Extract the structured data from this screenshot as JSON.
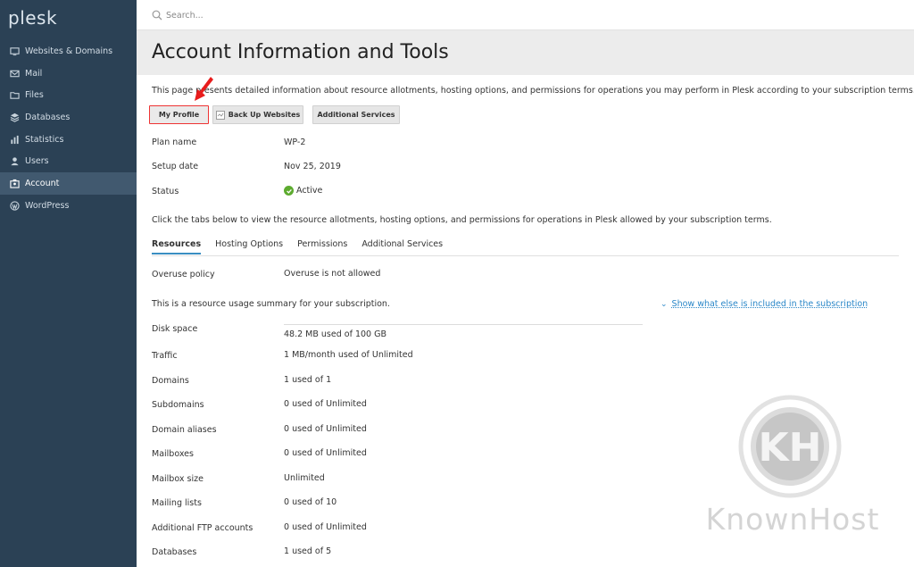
{
  "brand": {
    "logo": "plesk"
  },
  "sidebar": {
    "items": [
      {
        "label": "Websites & Domains",
        "icon": "monitor-icon"
      },
      {
        "label": "Mail",
        "icon": "mail-icon"
      },
      {
        "label": "Files",
        "icon": "folder-icon"
      },
      {
        "label": "Databases",
        "icon": "database-icon"
      },
      {
        "label": "Statistics",
        "icon": "bar-chart-icon"
      },
      {
        "label": "Users",
        "icon": "user-icon"
      },
      {
        "label": "Account",
        "icon": "account-icon",
        "active": true
      },
      {
        "label": "WordPress",
        "icon": "wordpress-icon"
      }
    ]
  },
  "search": {
    "placeholder": "Search..."
  },
  "page": {
    "title": "Account Information and Tools",
    "description": "This page presents detailed information about resource allotments, hosting options, and permissions for operations you may perform in Plesk according to your subscription terms."
  },
  "toolbar": {
    "my_profile": "My Profile",
    "back_up": "Back Up Websites",
    "additional_services": "Additional Services"
  },
  "info": {
    "plan_name_label": "Plan name",
    "plan_name_value": "WP-2",
    "setup_date_label": "Setup date",
    "setup_date_value": "Nov 25, 2019",
    "status_label": "Status",
    "status_value": "Active"
  },
  "tabs_intro": "Click the tabs below to view the resource allotments, hosting options, and permissions for operations in Plesk allowed by your subscription terms.",
  "tabs": [
    {
      "label": "Resources",
      "active": true
    },
    {
      "label": "Hosting Options"
    },
    {
      "label": "Permissions"
    },
    {
      "label": "Additional Services"
    }
  ],
  "resources": {
    "overuse_label": "Overuse policy",
    "overuse_value": "Overuse is not allowed",
    "summary": "This is a resource usage summary for your subscription.",
    "show_more": "Show what else is included in the subscription",
    "rows": [
      {
        "label": "Disk space",
        "value": "48.2 MB used of 100 GB"
      },
      {
        "label": "Traffic",
        "value": "1 MB/month used of Unlimited"
      },
      {
        "label": "Domains",
        "value": "1 used of 1"
      },
      {
        "label": "Subdomains",
        "value": "0 used of Unlimited"
      },
      {
        "label": "Domain aliases",
        "value": "0 used of Unlimited"
      },
      {
        "label": "Mailboxes",
        "value": "0 used of Unlimited"
      },
      {
        "label": "Mailbox size",
        "value": "Unlimited"
      },
      {
        "label": "Mailing lists",
        "value": "0 used of 10"
      },
      {
        "label": "Additional FTP accounts",
        "value": "0 used of Unlimited"
      },
      {
        "label": "Databases",
        "value": "1 used of 5"
      }
    ]
  },
  "watermark": {
    "text": "KnownHost",
    "monogram": "KH"
  },
  "colors": {
    "sidebar": "#2b4155",
    "active_nav": "#41596f",
    "link": "#2a87c8",
    "status_ok": "#5dab2f",
    "highlight": "#e33333"
  }
}
